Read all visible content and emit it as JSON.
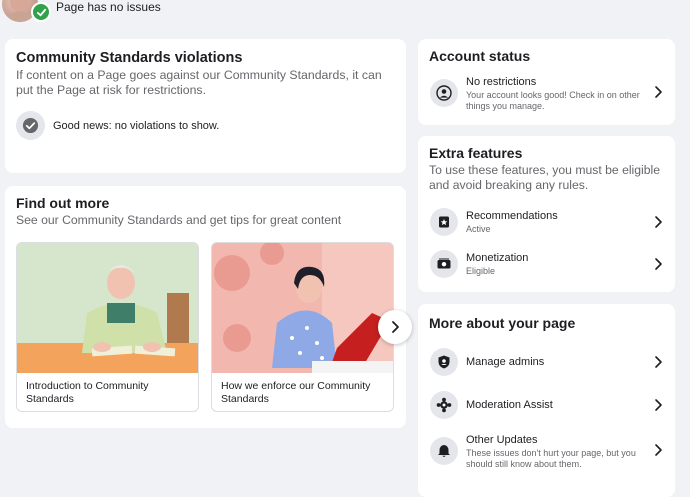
{
  "header": {
    "status_text": "Page has no issues"
  },
  "violations": {
    "title": "Community Standards violations",
    "description": "If content on a Page goes against our Community Standards, it can put the Page at risk for restrictions.",
    "good_news": "Good news: no violations to show."
  },
  "find_out_more": {
    "title": "Find out more",
    "subtitle": "See our Community Standards and get tips for great content",
    "cards": [
      {
        "caption": "Introduction to Community Standards"
      },
      {
        "caption": "How we enforce our Community Standards"
      }
    ]
  },
  "account_status": {
    "title": "Account status",
    "item_title": "No restrictions",
    "item_sub": "Your account looks good! Check in on other things you manage."
  },
  "extra_features": {
    "title": "Extra features",
    "description": "To use these features, you must be eligible and avoid breaking any rules.",
    "items": [
      {
        "title": "Recommendations",
        "status": "Active"
      },
      {
        "title": "Monetization",
        "status": "Eligible"
      }
    ]
  },
  "more_about": {
    "title": "More about your page",
    "items": [
      {
        "title": "Manage admins"
      },
      {
        "title": "Moderation Assist"
      },
      {
        "title": "Other Updates",
        "sub": "These issues don't hurt your page, but you should still know about them."
      }
    ]
  },
  "colors": {
    "success": "#31a24c",
    "background": "#f0f2f5",
    "icon_bg": "#e4e6eb"
  }
}
